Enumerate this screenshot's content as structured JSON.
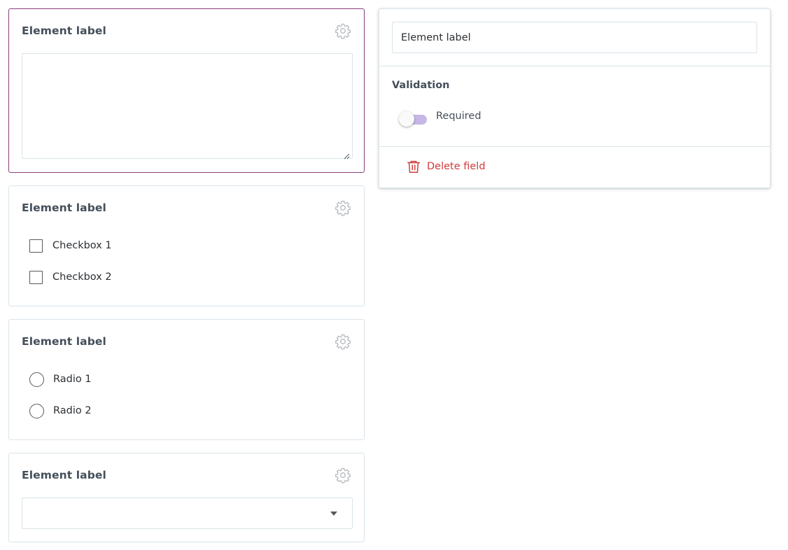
{
  "fields": {
    "textarea": {
      "label": "Element label",
      "value": ""
    },
    "checkbox_group": {
      "label": "Element label",
      "options": [
        "Checkbox 1",
        "Checkbox 2"
      ]
    },
    "radio_group": {
      "label": "Element label",
      "options": [
        "Radio 1",
        "Radio 2"
      ]
    },
    "dropdown": {
      "label": "Element label",
      "selected": ""
    }
  },
  "settings_panel": {
    "label_value": "Element label",
    "validation_title": "Validation",
    "required_label": "Required",
    "required_enabled": false,
    "delete_label": "Delete field"
  },
  "colors": {
    "active_border": "#8a3d7e",
    "toggle_track": "#c6b7e6",
    "danger": "#d03a3a",
    "border": "#d9e4ea"
  },
  "icons": {
    "settings": "gear-icon",
    "dropdown": "caret-down-icon",
    "delete": "trash-icon",
    "resize": "resize-grip-icon"
  }
}
